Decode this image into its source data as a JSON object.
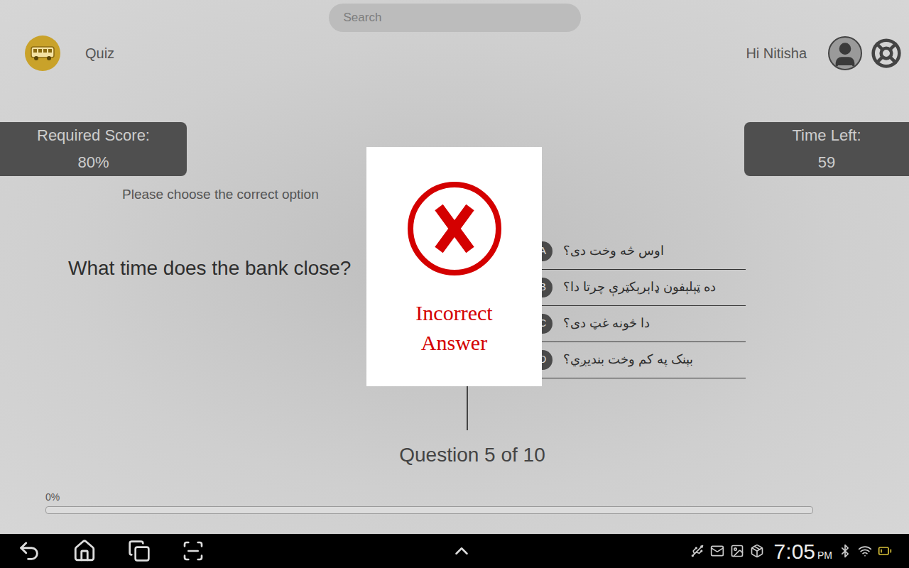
{
  "app": {
    "title": "Quiz"
  },
  "search": {
    "placeholder": "Search"
  },
  "user": {
    "greeting": "Hi Nitisha"
  },
  "required_score": {
    "label": "Required Score:",
    "value": "80%"
  },
  "time_left": {
    "label": "Time Left:",
    "value": "59"
  },
  "instruction": "Please choose the correct option",
  "question": {
    "text": "What time does the bank close?",
    "options": [
      {
        "letter": "A",
        "text": "اوس څه وخت دی؟"
      },
      {
        "letter": "B",
        "text": "ده ټېلېفون ډاېرېکټرې چرتا دا؟"
      },
      {
        "letter": "C",
        "text": "دا څونه غټ دی؟"
      },
      {
        "letter": "D",
        "text": "بېنک په کم وخت بندیږي؟"
      }
    ]
  },
  "counter": "Question 5 of 10",
  "progress": {
    "label": "0%",
    "level": 0
  },
  "dialog": {
    "message": "Incorrect Answer"
  },
  "status_bar": {
    "time": "7:05",
    "meridiem": "PM"
  }
}
